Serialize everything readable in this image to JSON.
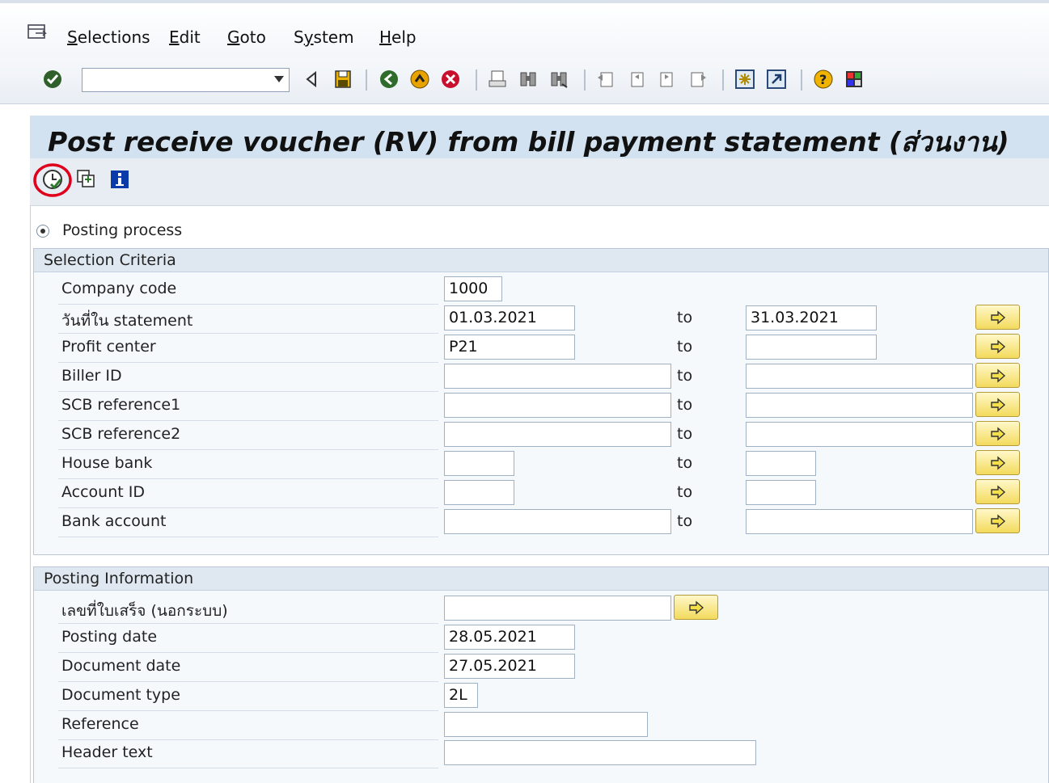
{
  "menu": {
    "items": [
      "Selections",
      "Edit",
      "Goto",
      "System",
      "Help"
    ],
    "underlines": [
      "S",
      "E",
      "G",
      "y",
      "H"
    ]
  },
  "toolbar": {
    "command_value": ""
  },
  "title": "Post receive voucher (RV) from bill payment statement (ส่วนงาน)",
  "radio": {
    "label": "Posting process",
    "selected": true
  },
  "selection_criteria": {
    "title": "Selection Criteria",
    "to_label": "to",
    "rows": [
      {
        "label": "Company code",
        "from": "1000",
        "to": null
      },
      {
        "label": "วันที่ใน statement",
        "from": "01.03.2021",
        "to": "31.03.2021"
      },
      {
        "label": "Profit center",
        "from": "P21",
        "to": ""
      },
      {
        "label": "Biller ID",
        "from": "",
        "to": ""
      },
      {
        "label": "SCB reference1",
        "from": "",
        "to": ""
      },
      {
        "label": "SCB reference2",
        "from": "",
        "to": ""
      },
      {
        "label": "House bank",
        "from": "",
        "to": ""
      },
      {
        "label": "Account ID",
        "from": "",
        "to": ""
      },
      {
        "label": "Bank account",
        "from": "",
        "to": ""
      }
    ]
  },
  "posting_info": {
    "title": "Posting Information",
    "rows": [
      {
        "label": "เลขที่ใบเสร็จ (นอกระบบ)",
        "value": ""
      },
      {
        "label": "Posting date",
        "value": "28.05.2021"
      },
      {
        "label": "Document date",
        "value": "27.05.2021"
      },
      {
        "label": "Document type",
        "value": "2L"
      },
      {
        "label": "Reference",
        "value": ""
      },
      {
        "label": "Header text",
        "value": ""
      }
    ]
  },
  "colors": {
    "title_bg": "#d3e2f0",
    "highlight_circle": "#e0001b",
    "multi_select_button": "#f3db5c"
  }
}
